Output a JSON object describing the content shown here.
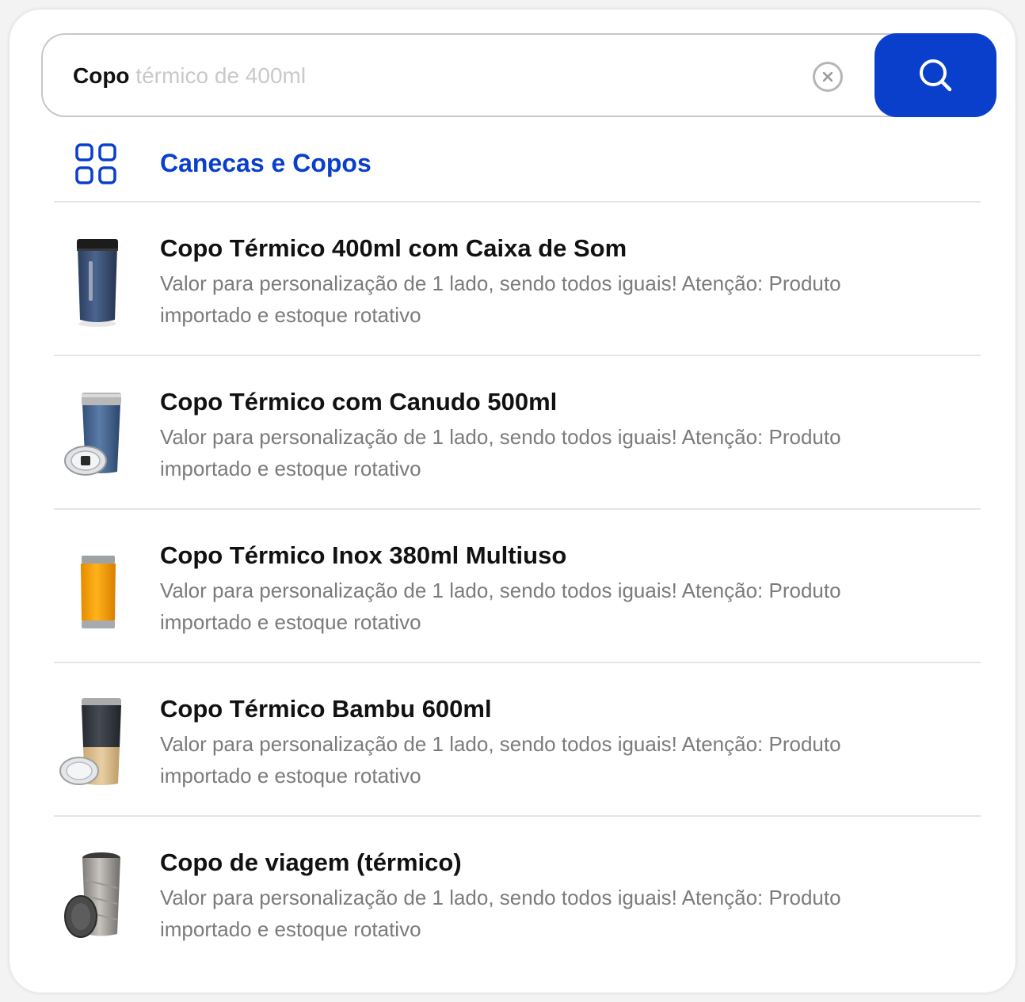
{
  "search": {
    "typed_text": "Copo",
    "suggestion_text": " térmico de 400ml",
    "clear_icon": "close-circle-icon",
    "button_icon": "search-icon"
  },
  "category": {
    "icon": "grid-icon",
    "label": "Canecas e Copos"
  },
  "results": [
    {
      "title": "Copo Térmico 400ml com Caixa de Som",
      "description": "Valor para personalização de 1 lado, sendo todos iguais! Atenção: Produto importado e estoque rotativo"
    },
    {
      "title": "Copo Térmico com Canudo 500ml",
      "description": "Valor para personalização de 1 lado, sendo todos iguais! Atenção: Produto importado e estoque rotativo"
    },
    {
      "title": "Copo Térmico Inox 380ml Multiuso",
      "description": "Valor para personalização de 1 lado, sendo todos iguais! Atenção: Produto importado e estoque rotativo"
    },
    {
      "title": "Copo Térmico Bambu 600ml",
      "description": "Valor para personalização de 1 lado, sendo todos iguais! Atenção: Produto importado e estoque rotativo"
    },
    {
      "title": "Copo de viagem (térmico)",
      "description": "Valor para personalização de 1 lado, sendo todos iguais! Atenção: Produto importado e estoque rotativo"
    }
  ],
  "colors": {
    "accent": "#0a3fcc",
    "title_text": "#111111",
    "description_text": "#7b7b7b",
    "suggestion_text": "#c9c9c9",
    "divider": "#e6e6e6"
  }
}
